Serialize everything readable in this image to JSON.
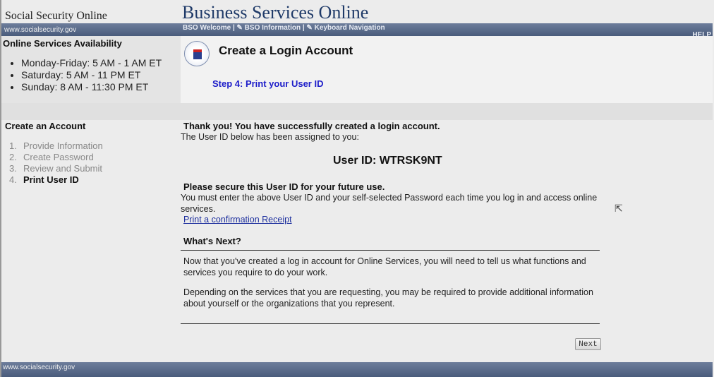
{
  "header": {
    "site_name": "Social Security Online",
    "app_title": "Business Services Online",
    "url": "www.socialsecurity.gov",
    "nav": "BSO Welcome | ✎ BSO Information | ✎ Keyboard Navigation",
    "help": "HELP"
  },
  "availability": {
    "title": "Online Services Availability",
    "items": [
      "Monday-Friday: 5 AM - 1 AM ET",
      "Saturday: 5 AM - 11 PM ET",
      "Sunday: 8 AM - 11:30 PM ET"
    ]
  },
  "page": {
    "title": "Create a Login Account",
    "step": "Step 4: Print your User ID"
  },
  "sidebar": {
    "title": "Create an Account",
    "steps": [
      {
        "num": "1.",
        "label": "Provide Information"
      },
      {
        "num": "2.",
        "label": "Create Password"
      },
      {
        "num": "3.",
        "label": "Review and Submit"
      },
      {
        "num": "4.",
        "label": "Print User ID"
      }
    ]
  },
  "main": {
    "thanks": "Thank you! You have successfully created a login account.",
    "assigned": "The User ID below has been assigned to you:",
    "user_id": "User ID: WTRSK9NT",
    "secure_heading": "Please secure this User ID for your future use.",
    "secure_text": "You must enter the above User ID and your self-selected Password each time you log in and access online services.",
    "print_link": "Print a confirmation Receipt",
    "next_heading": "What's Next?",
    "next_p1": "Now that you've created a log in account for Online Services, you will need to tell us what functions and services you require to do your work.",
    "next_p2": "Depending on the services that you are requesting, you may be required to provide additional information about yourself or the organizations that you represent.",
    "next_button": "Next"
  },
  "footer": {
    "url": "www.socialsecurity.gov"
  }
}
